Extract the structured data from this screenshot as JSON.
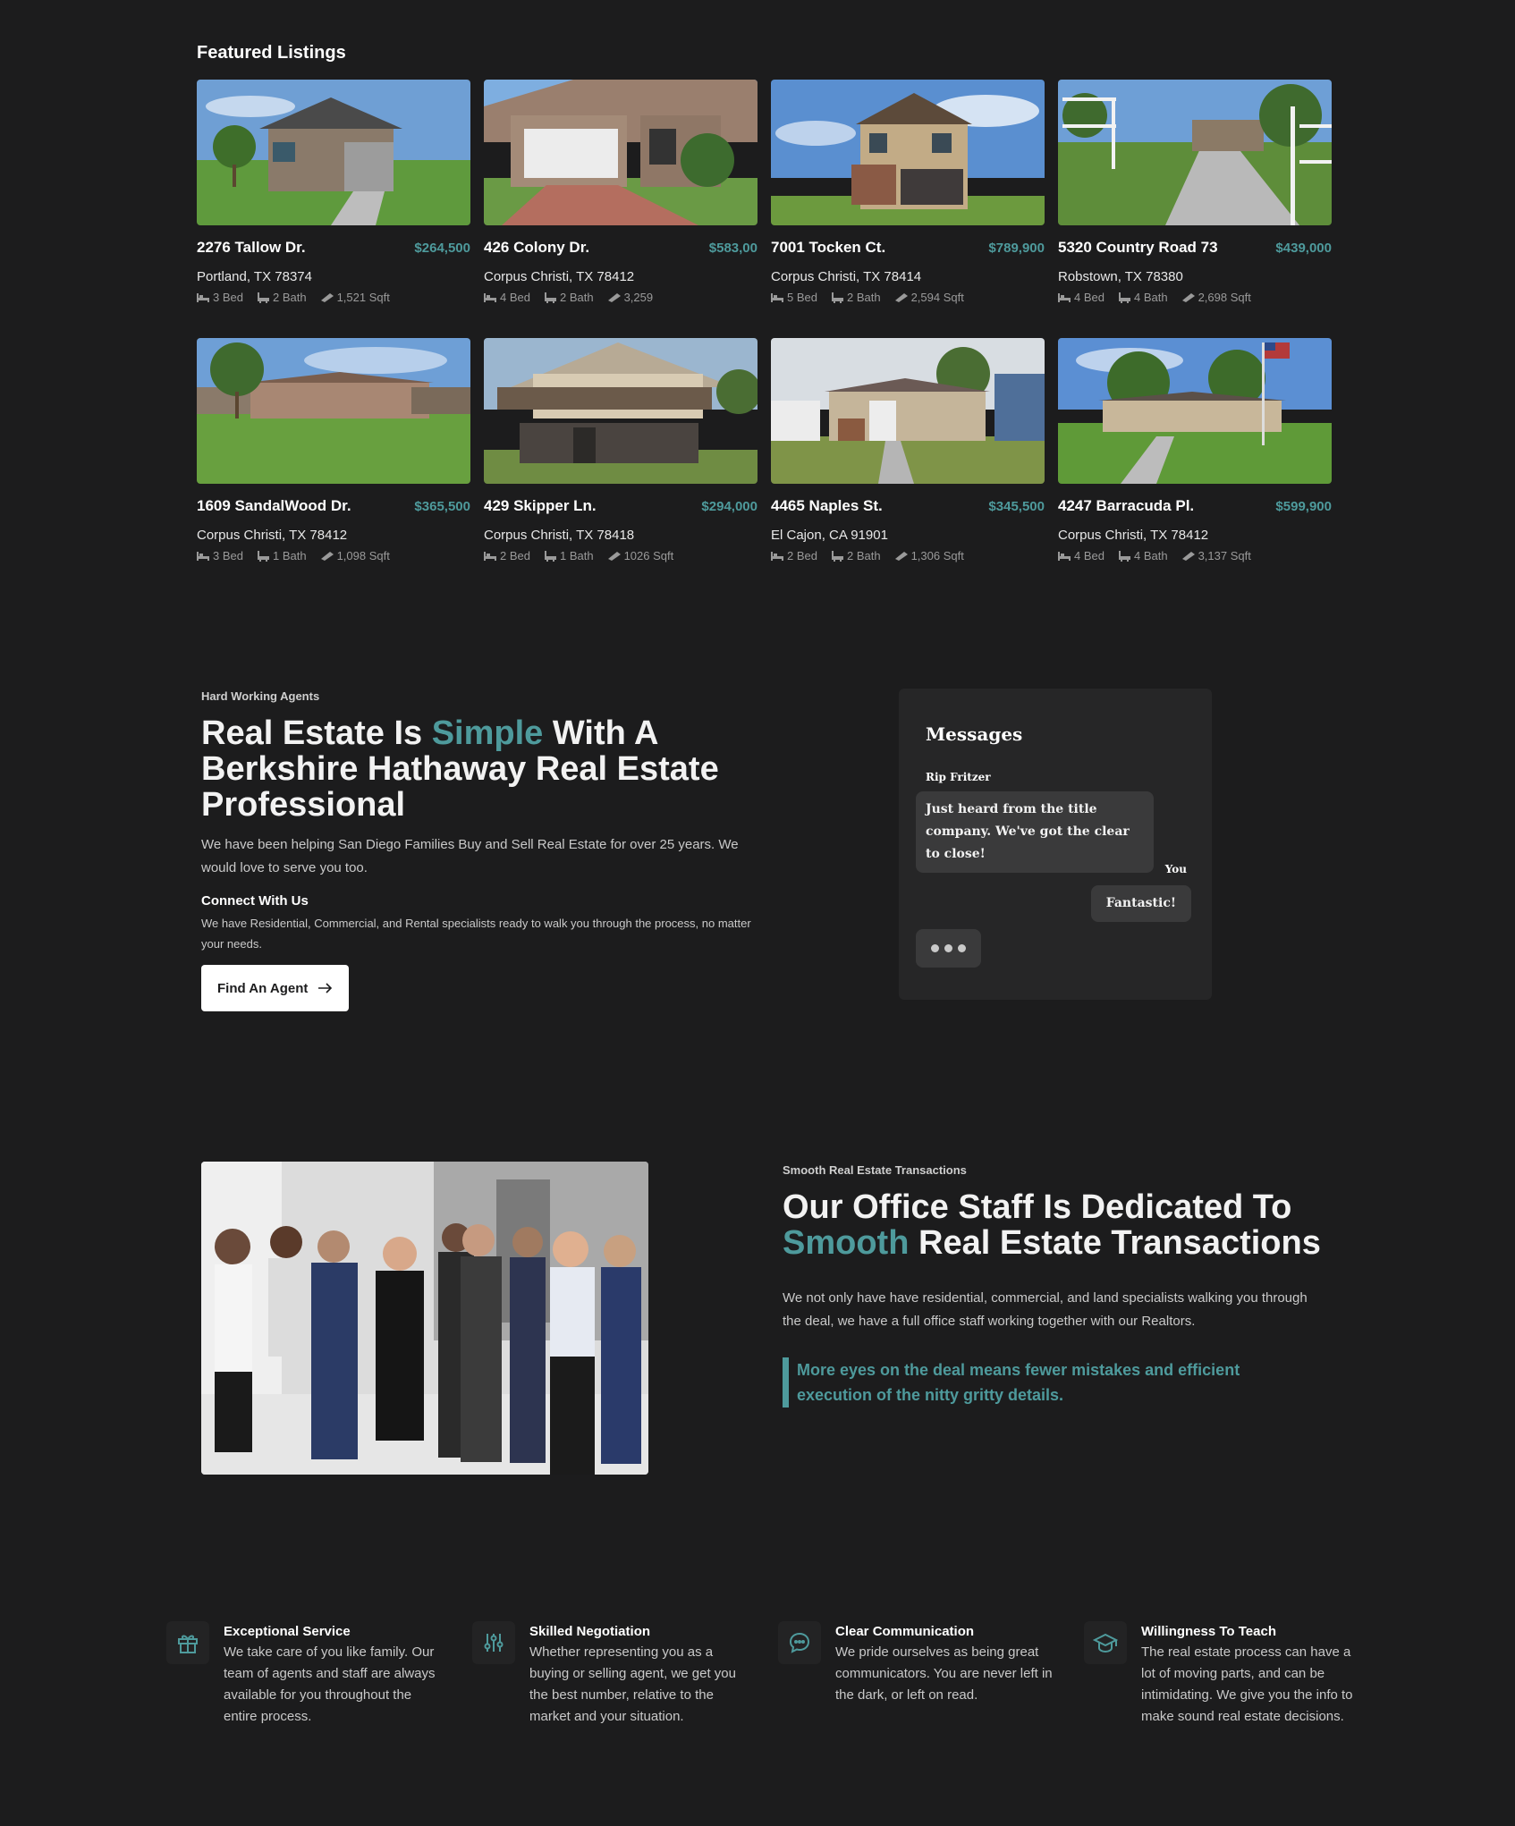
{
  "featured": {
    "title": "Featured Listings",
    "listings": [
      {
        "address": "2276 Tallow Dr.",
        "price": "$264,500",
        "city": "Portland, TX 78374",
        "bed": "3 Bed",
        "bath": "2 Bath",
        "sqft": "1,521 Sqft"
      },
      {
        "address": "426 Colony Dr.",
        "price": "$583,00",
        "city": "Corpus Christi, TX 78412",
        "bed": "4 Bed",
        "bath": "2 Bath",
        "sqft": "3,259"
      },
      {
        "address": "7001 Tocken Ct.",
        "price": "$789,900",
        "city": "Corpus Christi, TX 78414",
        "bed": "5 Bed",
        "bath": "2 Bath",
        "sqft": "2,594 Sqft"
      },
      {
        "address": "5320 Country Road 73",
        "price": "$439,000",
        "city": "Robstown, TX 78380",
        "bed": "4 Bed",
        "bath": "4 Bath",
        "sqft": "2,698 Sqft"
      },
      {
        "address": "1609 SandalWood Dr.",
        "price": "$365,500",
        "city": "Corpus Christi, TX 78412",
        "bed": "3 Bed",
        "bath": "1 Bath",
        "sqft": "1,098 Sqft"
      },
      {
        "address": "429 Skipper Ln.",
        "price": "$294,000",
        "city": "Corpus Christi, TX 78418",
        "bed": "2 Bed",
        "bath": "1 Bath",
        "sqft": "1026 Sqft"
      },
      {
        "address": "4465 Naples St.",
        "price": "$345,500",
        "city": "El Cajon, CA 91901",
        "bed": "2 Bed",
        "bath": "2 Bath",
        "sqft": "1,306 Sqft"
      },
      {
        "address": "4247 Barracuda Pl.",
        "price": "$599,900",
        "city": "Corpus Christi, TX 78412",
        "bed": "4 Bed",
        "bath": "4 Bath",
        "sqft": "3,137 Sqft"
      }
    ]
  },
  "agents": {
    "eyebrow": "Hard Working Agents",
    "heading_pre": "Real Estate Is ",
    "heading_accent": "Simple",
    "heading_post": " With A Berkshire Hathaway Real Estate Professional",
    "intro": "We have been helping San Diego Families Buy and Sell Real Estate for over 25 years. We would love to serve you too.",
    "connect_title": "Connect With Us",
    "connect_text": "We have Residential, Commercial, and Rental specialists ready to walk you through the process, no matter your needs.",
    "button_label": "Find An Agent"
  },
  "messages": {
    "title": "Messages",
    "sender": "Rip Fritzer",
    "incoming": "Just heard from the title company. We've got the clear to close!",
    "me_label": "You",
    "outgoing": "Fantastic!"
  },
  "staff": {
    "eyebrow": "Smooth Real Estate Transactions",
    "heading_line1": "Our Office Staff Is Dedicated To",
    "heading_accent": "Smooth",
    "heading_post": " Real Estate Transactions",
    "text": "We not only have have residential, commercial, and land specialists walking you through the deal, we have a full office staff working together with our Realtors.",
    "quote": "More eyes on the deal means fewer mistakes and efficient execution of the nitty gritty details."
  },
  "features": [
    {
      "icon": "gift-icon",
      "title": "Exceptional Service",
      "text": "We take care of you like family. Our team of agents and staff are always available for you throughout the entire process."
    },
    {
      "icon": "sliders-icon",
      "title": "Skilled Negotiation",
      "text": "Whether representing you as a buying or selling agent, we get you the best number, relative to the market and your situation."
    },
    {
      "icon": "chat-icon",
      "title": "Clear Communication",
      "text": "We pride ourselves as being great communicators. You are never left in the dark, or left on read."
    },
    {
      "icon": "graduation-cap-icon",
      "title": "Willingness To Teach",
      "text": "The real estate process can have a lot of moving parts, and can be intimidating. We give you the info to make sound real estate decisions."
    }
  ],
  "colors": {
    "background": "#1c1c1d",
    "accent": "#4e9a9c",
    "panel": "#262627"
  }
}
